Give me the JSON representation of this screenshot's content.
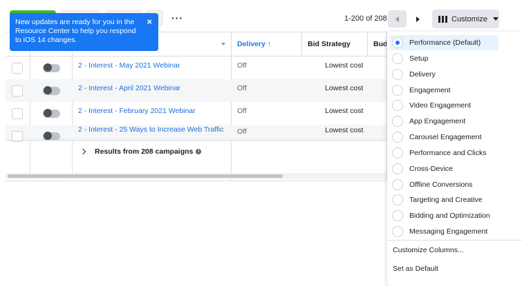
{
  "toolbar": {
    "more_label": "···",
    "pager_text": "1-200 of 208",
    "customize_label": "Customize"
  },
  "tooltip": {
    "text": "New updates are ready for you in the Resource Center to help you respond to iOS 14 changes.",
    "close": "×"
  },
  "table": {
    "headers": {
      "delivery": "Delivery ↑",
      "bid_strategy": "Bid Strategy",
      "budget_truncated": "Budg"
    },
    "rows": [
      {
        "name": "2 - Interest - May 2021 Webinar",
        "delivery": "Off",
        "bid_strategy": "Lowest cost"
      },
      {
        "name": "2 - Interest - April 2021 Webinar",
        "delivery": "Off",
        "bid_strategy": "Lowest cost"
      },
      {
        "name": "2 - Interest - February 2021 Webinar",
        "delivery": "Off",
        "bid_strategy": "Lowest cost"
      },
      {
        "name": "2 - Interest - 25 Ways to Increase Web Traffic",
        "delivery": "Off",
        "bid_strategy": "Lowest cost"
      }
    ],
    "summary": "Results from 208 campaigns"
  },
  "dropdown": {
    "options": [
      "Performance (Default)",
      "Setup",
      "Delivery",
      "Engagement",
      "Video Engagement",
      "App Engagement",
      "Carousel Engagement",
      "Performance and Clicks",
      "Cross-Device",
      "Offline Conversions",
      "Targeting and Creative",
      "Bidding and Optimization",
      "Messaging Engagement"
    ],
    "selected": "Performance (Default)",
    "customize_columns": "Customize Columns...",
    "set_default": "Set as Default"
  },
  "colors": {
    "accent": "#1877f2",
    "link": "#216fdb",
    "green": "#42b72a"
  }
}
